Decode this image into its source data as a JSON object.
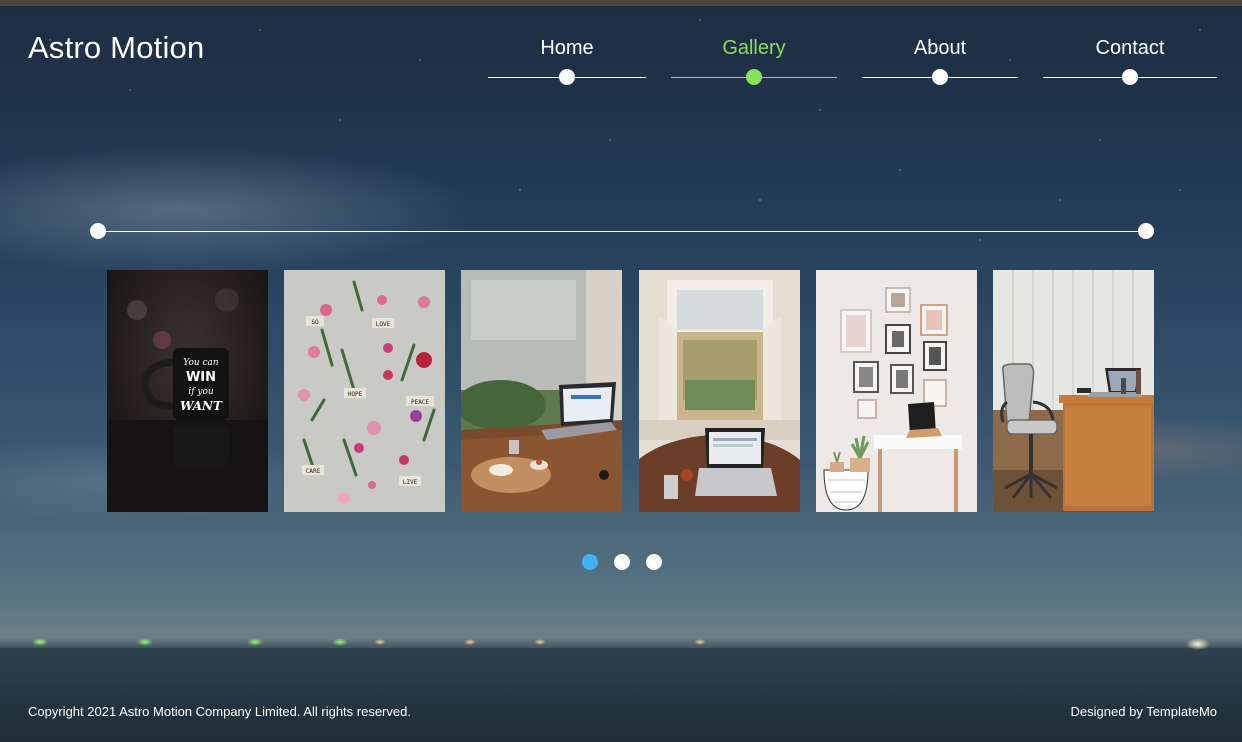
{
  "brand": {
    "title": "Astro Motion"
  },
  "nav": {
    "items": [
      {
        "label": "Home",
        "active": false
      },
      {
        "label": "Gallery",
        "active": true
      },
      {
        "label": "About",
        "active": false
      },
      {
        "label": "Contact",
        "active": false
      }
    ],
    "active_color": "#8be05a"
  },
  "gallery": {
    "photos": [
      {
        "subject": "Black mug with text",
        "mug_text": [
          "You can",
          "WIN",
          "if you",
          "WANT"
        ]
      },
      {
        "subject": "Flowers with word tags",
        "tags": [
          "SO",
          "LOVE",
          "HOPE",
          "PEACE",
          "CARE",
          "LIVE"
        ]
      },
      {
        "subject": "Laptop on cafe table"
      },
      {
        "subject": "Laptop by open window"
      },
      {
        "subject": "White desk with picture frames"
      },
      {
        "subject": "Office chair and desk"
      }
    ]
  },
  "pager": {
    "pages": 3,
    "current": 1,
    "active_color": "#3fb4f2"
  },
  "footer": {
    "copyright": "Copyright 2021 Astro Motion Company Limited. All rights reserved.",
    "credit": "Designed by TemplateMo"
  }
}
